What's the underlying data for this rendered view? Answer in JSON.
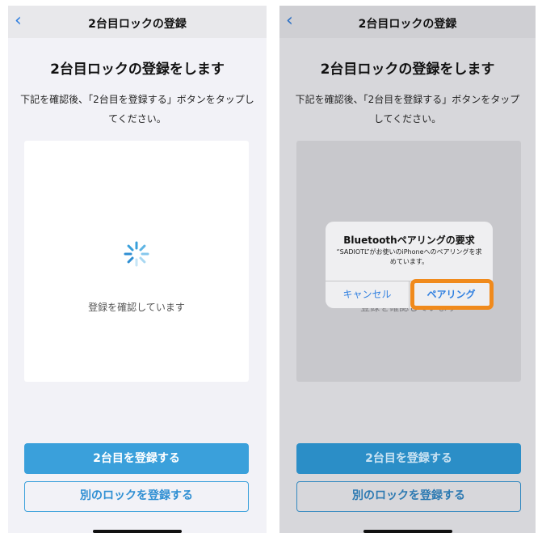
{
  "colors": {
    "accent": "#3aa0db",
    "highlight": "#f08a1c",
    "link": "#2f7fe0"
  },
  "left": {
    "navbar": {
      "back_icon": "chevron-left-icon",
      "title": "2台目ロックの登録"
    },
    "heading": "2台目ロックの登録をします",
    "description": "下記を確認後、「2台目を登録する」ボタンをタップしてください。",
    "card": {
      "status": "登録を確認しています",
      "spinner_icon": "activity-spinner-icon"
    },
    "primary_button": "2台目を登録する",
    "secondary_button": "別のロックを登録する"
  },
  "right": {
    "navbar": {
      "back_icon": "chevron-left-icon",
      "title": "2台目ロックの登録"
    },
    "heading": "2台目ロックの登録をします",
    "description": "下記を確認後、「2台目を登録する」ボタンをタップしてください。",
    "card": {
      "status": "登録を確認しています"
    },
    "alert": {
      "title": "Bluetoothペアリングの要求",
      "message": "“SADIOTL”がお使いのiPhoneへのペアリングを求めています。",
      "cancel_label": "キャンセル",
      "pair_label": "ペアリング"
    },
    "primary_button": "2台目を登録する",
    "secondary_button": "別のロックを登録する"
  }
}
